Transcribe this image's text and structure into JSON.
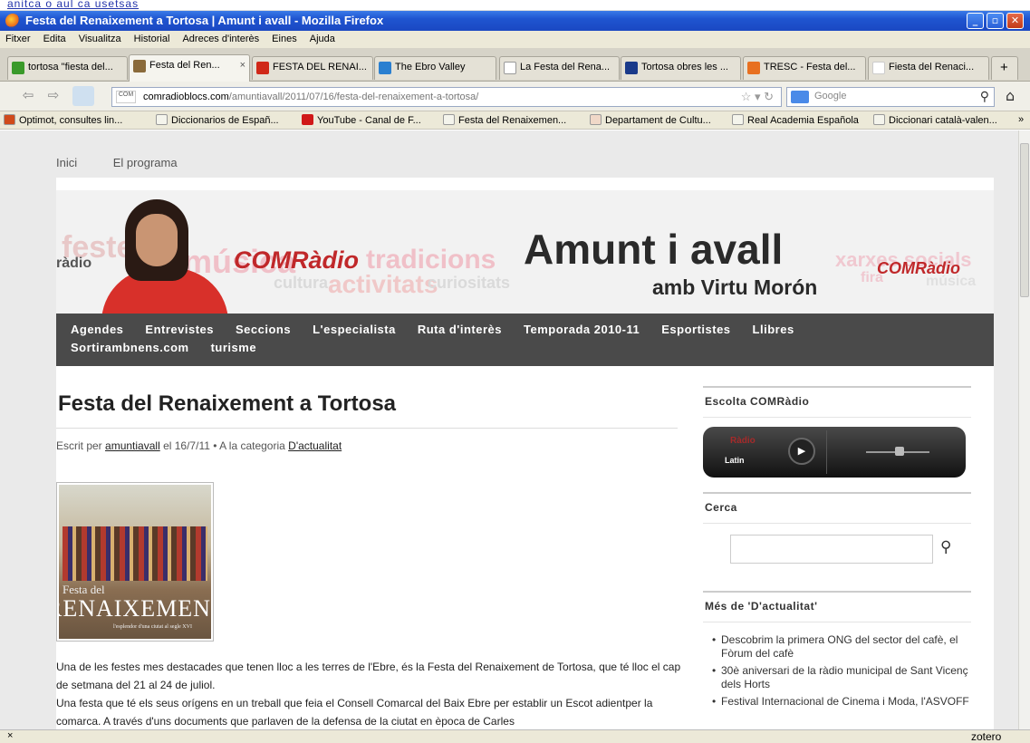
{
  "top_strip": {
    "text": "anitca o aul ca usetsas"
  },
  "window": {
    "title": "Festa del Renaixement a Tortosa | Amunt i avall - Mozilla Firefox"
  },
  "menu": [
    "Fitxer",
    "Edita",
    "Visualitza",
    "Historial",
    "Adreces d'interès",
    "Eines",
    "Ajuda"
  ],
  "tabs": [
    {
      "label": "tortosa \"fiesta del...",
      "color": "#3a9a2a"
    },
    {
      "label": "Festa del Ren...",
      "color": "#8a6a3a",
      "active": true,
      "close": "×"
    },
    {
      "label": "FESTA DEL RENAI...",
      "color": "#d02818"
    },
    {
      "label": "The Ebro Valley",
      "color": "#2a7fd0"
    },
    {
      "label": "La Festa del Rena...",
      "color": "#ffffff"
    },
    {
      "label": "Tortosa obres les ...",
      "color": "#1a3a8a"
    },
    {
      "label": "TRESC - Festa del...",
      "color": "#e87020"
    },
    {
      "label": "Fiesta del Renaci...",
      "color": "#ffffff"
    }
  ],
  "tab_new": "+",
  "address": {
    "domain": "comradioblocs.com",
    "path": "/amuntiavall/2011/07/16/festa-del-renaixement-a-tortosa/"
  },
  "search": {
    "placeholder": "Google"
  },
  "bookmarks": [
    "Optimot, consultes lin...",
    "Diccionarios de Españ...",
    "YouTube - Canal de F...",
    "Festa del Renaixemen...",
    "Departament de Cultu...",
    "Real Academia Española",
    "Diccionari català-valen..."
  ],
  "bookmarks_more": "»",
  "site_nav": [
    "Inici",
    "El programa"
  ],
  "header": {
    "title": "Amunt i avall",
    "subtitle": "amb Virtu Morón",
    "brand": "COMRàdio",
    "words": [
      "festes",
      "música",
      "cultura",
      "activitats",
      "tradicions",
      "curiositats",
      "xarxes socials",
      "fira",
      "ràdio",
      "música"
    ]
  },
  "main_nav": [
    "Agendes",
    "Entrevistes",
    "Seccions",
    "L'especialista",
    "Ruta d'interès",
    "Temporada 2010-11",
    "Esportistes",
    "Llibres",
    "Sortirambnens.com",
    "turisme"
  ],
  "post": {
    "title": "Festa del Renaixement a Tortosa",
    "meta_prefix": "Escrit per",
    "author": "amuntiavall",
    "meta_date": "el 16/7/11 • A la categoria",
    "category": "D'actualitat",
    "image_text_1": "Festa del",
    "image_text_2": "RENAIXEMENT",
    "image_text_3": "l'esplendor d'una ciutat al segle XVI",
    "paragraphs": [
      "Una de les festes mes destacades que tenen lloc a les terres de l'Ebre, és la Festa del Renaixement de Tortosa, que té lloc el cap de setmana del 21 al 24 de juliol.",
      "Una festa que té els seus orígens en un treball que feia el Consell Comarcal del Baix Ebre per establir un Escot adientper la comarca. A través d'uns documents que parlaven de la defensa de la ciutat en època de Carles"
    ]
  },
  "sidebar": {
    "listen_title": "Escolta COMRàdio",
    "player_logo_1": "Ràdio",
    "player_logo_2": "Latin",
    "search_title": "Cerca",
    "more_title": "Més de 'D'actualitat'",
    "more_items": [
      "Descobrim la primera ONG del sector del cafè, el Fòrum del cafè",
      "30è aniversari de la ràdio municipal de Sant Vicenç dels Horts",
      "Festival Internacional de Cinema i Moda, l'ASVOFF"
    ]
  },
  "status": {
    "close": "×",
    "addon": "zotero"
  }
}
